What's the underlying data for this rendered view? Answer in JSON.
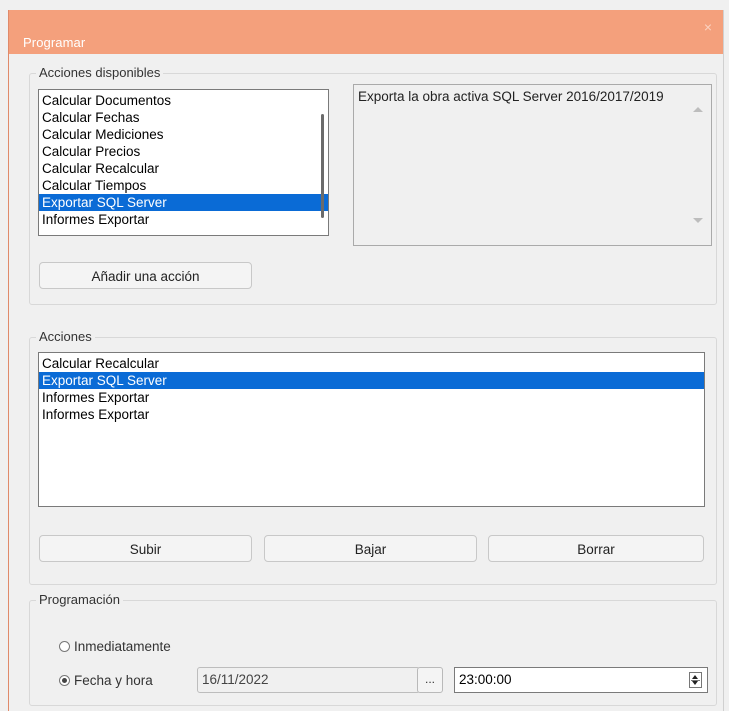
{
  "window": {
    "title": "Programar",
    "close_glyph": "×"
  },
  "available": {
    "legend": "Acciones disponibles",
    "items": [
      {
        "label": "Calcular Documentos",
        "selected": false
      },
      {
        "label": "Calcular Fechas",
        "selected": false
      },
      {
        "label": "Calcular Mediciones",
        "selected": false
      },
      {
        "label": "Calcular Precios",
        "selected": false
      },
      {
        "label": "Calcular Recalcular",
        "selected": false
      },
      {
        "label": "Calcular Tiempos",
        "selected": false
      },
      {
        "label": "Exportar SQL Server",
        "selected": true
      },
      {
        "label": "Informes Exportar",
        "selected": false
      }
    ],
    "description": "Exporta la obra activa SQL Server 2016/2017/2019",
    "add_button": "Añadir una acción"
  },
  "actions": {
    "legend": "Acciones",
    "items": [
      {
        "label": "Calcular Recalcular",
        "selected": false
      },
      {
        "label": "Exportar SQL Server",
        "selected": true
      },
      {
        "label": "Informes Exportar",
        "selected": false
      },
      {
        "label": "Informes Exportar",
        "selected": false
      }
    ],
    "up_button": "Subir",
    "down_button": "Bajar",
    "delete_button": "Borrar"
  },
  "schedule": {
    "legend": "Programación",
    "immediate_label": "Inmediatamente",
    "immediate_checked": false,
    "datetime_label": "Fecha y hora",
    "datetime_checked": true,
    "date_value": "16/11/2022",
    "browse_button": "...",
    "time_value": "23:00:00"
  },
  "colors": {
    "titlebar": "#f4a07c",
    "selection": "#0a6bd6"
  },
  "icons": {
    "close": "close-icon",
    "scroll_up": "scroll-up-icon",
    "scroll_down": "scroll-down-icon",
    "spinner": "spinner-icon"
  }
}
